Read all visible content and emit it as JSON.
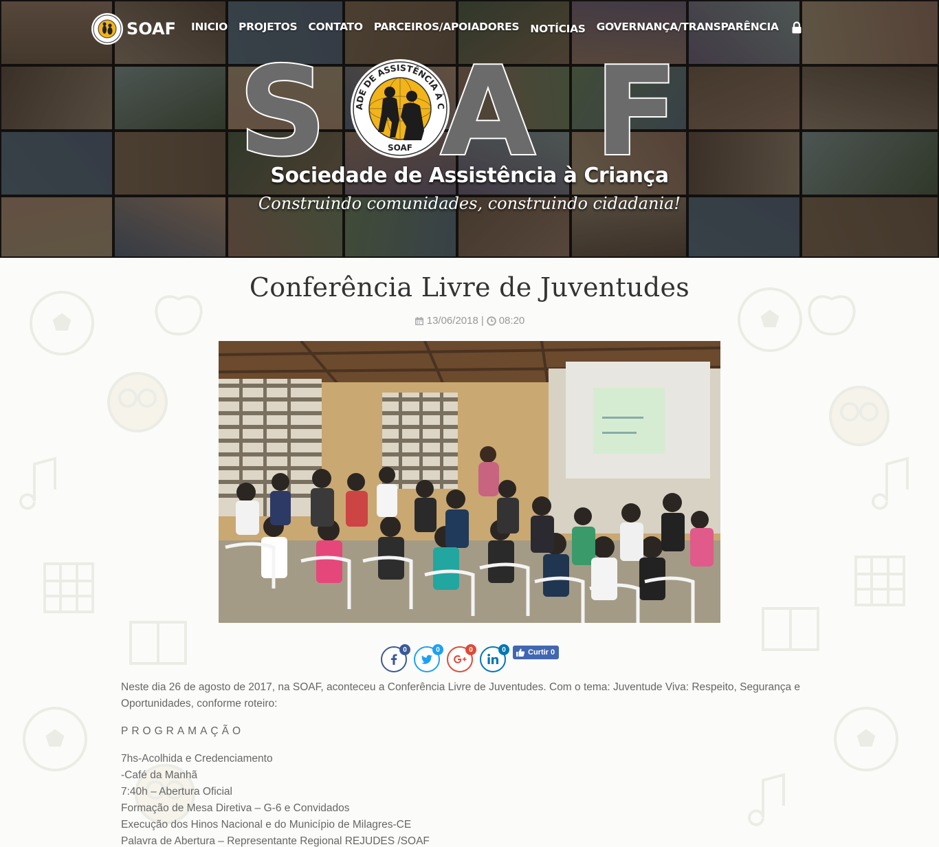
{
  "brand": {
    "name": "SOAF"
  },
  "nav": {
    "items": [
      "INICIO",
      "PROJETOS",
      "CONTATO",
      "PARCEIROS/APOIADORES",
      "NOTÍCIAS",
      "GOVERNANÇA/TRANSPARÊNCIA"
    ]
  },
  "hero": {
    "logo_text": "SOAF",
    "seal_text": "SOCIEDADE DE ASSISTÊNCIA À CRIANÇA",
    "seal_bottom": "SOAF",
    "org_name": "Sociedade de Assistência à Criança",
    "slogan": "Construindo comunidades, construindo cidadania!"
  },
  "article": {
    "title": "Conferência Livre de Juventudes",
    "date": "13/06/2018",
    "separator": "|",
    "time": "08:20",
    "intro": "Neste dia 26 de agosto de 2017, na SOAF, aconteceu a Conferência Livre de Juventudes. Com o tema: Juventude Viva: Respeito, Segurança e Oportunidades, conforme roteiro:",
    "program_heading": "PROGRAMAÇÃO",
    "schedule": [
      "7hs-Acolhida e Credenciamento",
      "-Café da Manhã",
      "7:40h – Abertura Oficial",
      "Formação de Mesa Diretiva – G-6 e Convidados",
      "Execução dos Hinos Nacional e do Município de Milagres-CE",
      "Palavra de Abertura – Representante Regional REJUDES /SOAF"
    ]
  },
  "share": {
    "facebook_count": "0",
    "twitter_count": "0",
    "googleplus_count": "0",
    "linkedin_count": "0",
    "like_label": "Curtir 0"
  },
  "colors": {
    "facebook": "#3b5998",
    "twitter": "#1da1f2",
    "googleplus": "#dd4b39",
    "linkedin": "#0077b5",
    "logo_gray": "#6b6b6b",
    "seal_yellow": "#f2b418"
  },
  "icons": [
    "lock-icon",
    "calendar-icon",
    "clock-icon",
    "facebook-icon",
    "twitter-icon",
    "google-plus-icon",
    "linkedin-icon",
    "thumbs-up-icon"
  ]
}
